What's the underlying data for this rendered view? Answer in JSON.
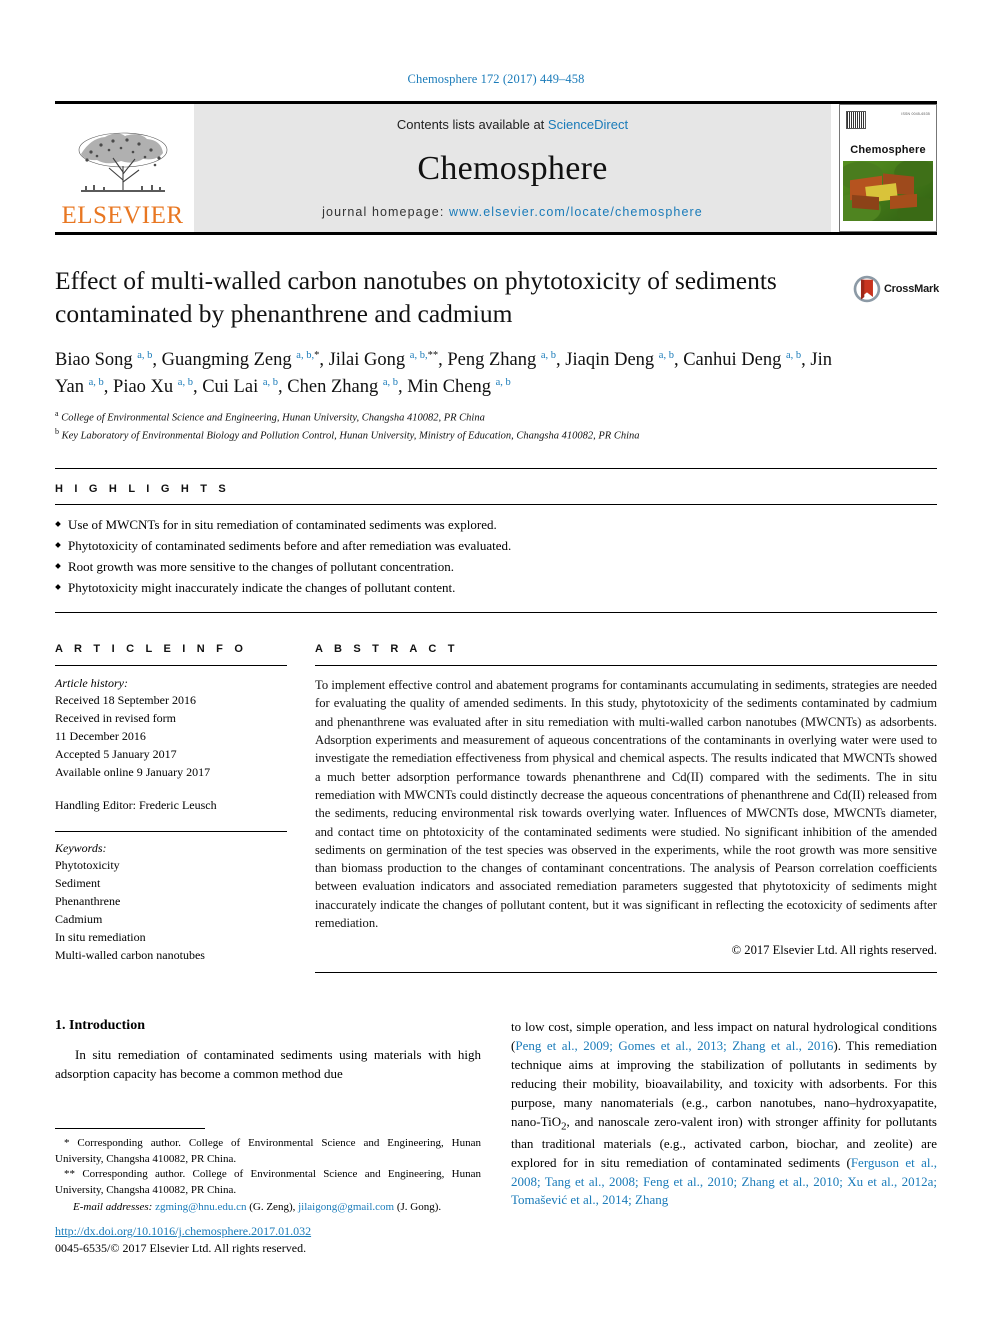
{
  "running_head": "Chemosphere 172 (2017) 449–458",
  "masthead": {
    "publisher_logo_text": "ELSEVIER",
    "contents_prefix": "Contents lists available at ",
    "contents_link": "ScienceDirect",
    "journal_name": "Chemosphere",
    "homepage_prefix": "journal homepage: ",
    "homepage_url": "www.elsevier.com/locate/chemosphere",
    "cover_title": "Chemosphere",
    "cover_tiny_text": "ISSN 0045-6535"
  },
  "article": {
    "title": "Effect of multi-walled carbon nanotubes on phytotoxicity of sediments contaminated by phenanthrene and cadmium",
    "crossmark_label": "CrossMark",
    "authors_html": "Biao Song <sup>a, b</sup>, Guangming Zeng <sup>a, b,</sup><sup class=\"star\">*</sup>, Jilai Gong <sup>a, b,</sup><sup class=\"star\">**</sup>, Peng Zhang <sup>a, b</sup>, Jiaqin Deng <sup>a, b</sup>, Canhui Deng <sup>a, b</sup>, Jin Yan <sup>a, b</sup>, Piao Xu <sup>a, b</sup>, Cui Lai <sup>a, b</sup>, Chen Zhang <sup>a, b</sup>, Min Cheng <sup>a, b</sup>",
    "affiliations": [
      {
        "marker": "a",
        "text": "College of Environmental Science and Engineering, Hunan University, Changsha 410082, PR China"
      },
      {
        "marker": "b",
        "text": "Key Laboratory of Environmental Biology and Pollution Control, Hunan University, Ministry of Education, Changsha 410082, PR China"
      }
    ]
  },
  "highlights": {
    "heading": "H I G H L I G H T S",
    "items": [
      "Use of MWCNTs for in situ remediation of contaminated sediments was explored.",
      "Phytotoxicity of contaminated sediments before and after remediation was evaluated.",
      "Root growth was more sensitive to the changes of pollutant concentration.",
      "Phytotoxicity might inaccurately indicate the changes of pollutant content."
    ]
  },
  "article_info": {
    "heading": "A R T I C L E  I N F O",
    "history_label": "Article history:",
    "history": [
      "Received 18 September 2016",
      "Received in revised form",
      "11 December 2016",
      "Accepted 5 January 2017",
      "Available online 9 January 2017"
    ],
    "handling_editor": "Handling Editor: Frederic Leusch",
    "keywords_label": "Keywords:",
    "keywords": [
      "Phytotoxicity",
      "Sediment",
      "Phenanthrene",
      "Cadmium",
      "In situ remediation",
      "Multi-walled carbon nanotubes"
    ]
  },
  "abstract": {
    "heading": "A B S T R A C T",
    "text": "To implement effective control and abatement programs for contaminants accumulating in sediments, strategies are needed for evaluating the quality of amended sediments. In this study, phytotoxicity of the sediments contaminated by cadmium and phenanthrene was evaluated after in situ remediation with multi-walled carbon nanotubes (MWCNTs) as adsorbents. Adsorption experiments and measurement of aqueous concentrations of the contaminants in overlying water were used to investigate the remediation effectiveness from physical and chemical aspects. The results indicated that MWCNTs showed a much better adsorption performance towards phenanthrene and Cd(II) compared with the sediments. The in situ remediation with MWCNTs could distinctly decrease the aqueous concentrations of phenanthrene and Cd(II) released from the sediments, reducing environmental risk towards overlying water. Influences of MWCNTs dose, MWCNTs diameter, and contact time on phtotoxicity of the contaminated sediments were studied. No significant inhibition of the amended sediments on germination of the test species was observed in the experiments, while the root growth was more sensitive than biomass production to the changes of contaminant concentrations. The analysis of Pearson correlation coefficients between evaluation indicators and associated remediation parameters suggested that phytotoxicity of sediments might inaccurately indicate the changes of pollutant content, but it was significant in reflecting the ecotoxicity of sediments after remediation.",
    "copyright": "© 2017 Elsevier Ltd. All rights reserved."
  },
  "introduction": {
    "heading": "1. Introduction",
    "left_paragraph": "In situ remediation of contaminated sediments using materials with high adsorption capacity has become a common method due",
    "right_part1": "to low cost, simple operation, and less impact on natural hydrological conditions (",
    "right_cite1": "Peng et al., 2009; Gomes et al., 2013; Zhang et al., 2016",
    "right_part2": "). This remediation technique aims at improving the stabilization of pollutants in sediments by reducing their mobility, bioavailability, and toxicity with adsorbents. For this purpose, many nanomaterials (e.g., carbon nanotubes, nano–hydroxyapatite, nano-TiO",
    "right_sub": "2",
    "right_part3": ", and nanoscale zero-valent iron) with stronger affinity for pollutants than traditional materials (e.g., activated carbon, biochar, and zeolite) are explored for in situ remediation of contaminated sediments (",
    "right_cite2": "Ferguson et al., 2008; Tang et al., 2008; Feng et al., 2010; Zhang et al., 2010; Xu et al., 2012a; Tomašević et al., 2014; Zhang"
  },
  "footnotes": {
    "corresponding1_marker": "*",
    "corresponding1": "Corresponding author. College of Environmental Science and Engineering, Hunan University, Changsha 410082, PR China.",
    "corresponding2_marker": "**",
    "corresponding2": "Corresponding author. College of Environmental Science and Engineering, Hunan University, Changsha 410082, PR China.",
    "email_label": "E-mail addresses:",
    "email1": "zgming@hnu.edu.cn",
    "email1_owner": "(G. Zeng),",
    "email2": "jilaigong@gmail.com",
    "email2_owner": "(J. Gong).",
    "doi": "http://dx.doi.org/10.1016/j.chemosphere.2017.01.032",
    "issn_line": "0045-6535/© 2017 Elsevier Ltd. All rights reserved."
  },
  "colors": {
    "link_blue": "#1a7bb9",
    "elsevier_orange": "#e87722",
    "masthead_gray": "#e6e6e6"
  }
}
